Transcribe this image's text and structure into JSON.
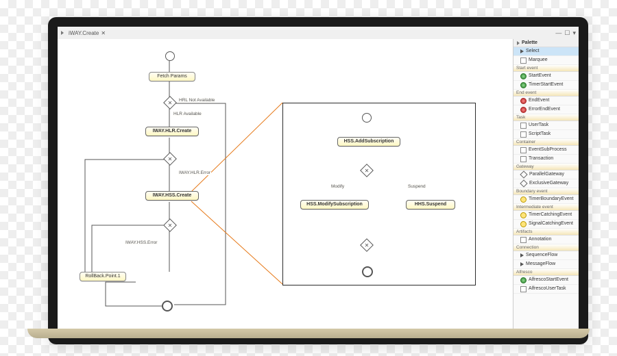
{
  "tab": {
    "title": "iWAY.Create",
    "close": "✕"
  },
  "window": {
    "min": "—",
    "max": "☐",
    "menu": "▾"
  },
  "palette": {
    "header": "Palette",
    "tools": {
      "select": "Select",
      "marquee": "Marquee"
    },
    "groups": {
      "start_event": "Start event",
      "end_event": "End event",
      "task": "Task",
      "container": "Container",
      "gateway": "Gateway",
      "boundary_event": "Boundary event",
      "intermediate_event": "Intermediate event",
      "artifacts": "Artifacts",
      "connection": "Connection",
      "alfresco": "Alfresco"
    },
    "items": {
      "start_event_item": "StartEvent",
      "timer_start_event": "TimerStartEvent",
      "end_event_item": "EndEvent",
      "error_end_event": "ErrorEndEvent",
      "user_task": "UserTask",
      "script_task": "ScriptTask",
      "event_sub_process": "EventSubProcess",
      "transaction": "Transaction",
      "parallel_gateway": "ParallelGateway",
      "exclusive_gateway": "ExclusiveGateway",
      "timer_boundary_event": "TimerBoundaryEvent",
      "timer_catching_event": "TimerCatchingEvent",
      "signal_catching_event": "SignalCatchingEvent",
      "annotation": "Annotation",
      "sequence_flow": "SequenceFlow",
      "message_flow": "MessageFlow",
      "alfresco_start_event": "AlfrescoStartEvent",
      "alfresco_user_task": "AlfrescoUserTask"
    }
  },
  "flow": {
    "fetch_params": "Fetch Params",
    "hlr_not_available": "HRL Not Available",
    "hlr_available": "HLR Available",
    "iway_hlr_create": "IWAY.HLR.Create",
    "iway_hlr_error": "IWAY.HLR.Error",
    "iway_hss_create": "IWAY.HSS.Create",
    "iway_hss_error": "IWAY.HSS.Error",
    "rollback_point": "RollBack.Point.1",
    "hss_add_sub": "HSS.AddSubscription",
    "modify": "Modify",
    "suspend": "Suspend",
    "hss_modify_sub": "HSS.ModifySubscription",
    "hhs_suspend": "HHS.Suspend"
  }
}
